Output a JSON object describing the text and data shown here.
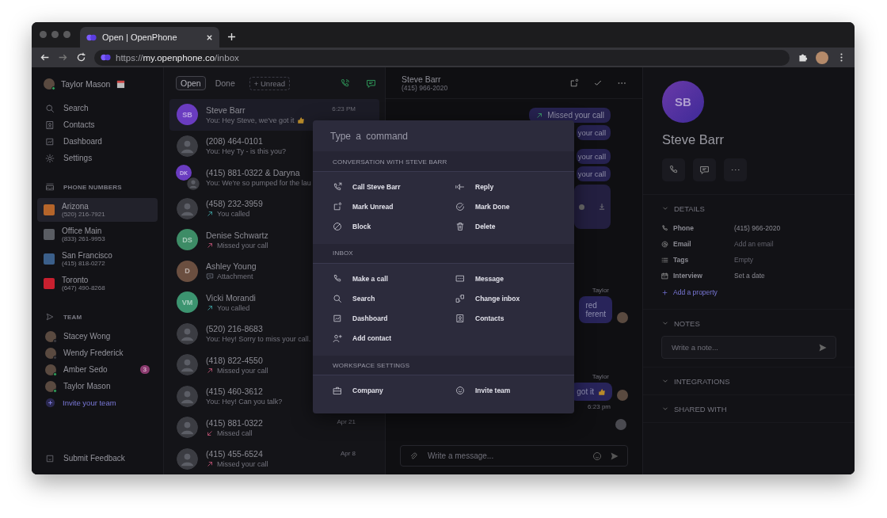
{
  "browser": {
    "tab_title": "Open | OpenPhone",
    "url_scheme": "https://",
    "url_host": "my.openphone.co",
    "url_path": "/inbox"
  },
  "sidebar": {
    "user": {
      "name": "Taylor Mason"
    },
    "nav": [
      {
        "label": "Search"
      },
      {
        "label": "Contacts"
      },
      {
        "label": "Dashboard"
      },
      {
        "label": "Settings"
      }
    ],
    "phone_numbers_heading": "PHONE NUMBERS",
    "phone_numbers": [
      {
        "name": "Arizona",
        "number": "(520) 216-7921",
        "selected": true,
        "color": "#b5652a"
      },
      {
        "name": "Office Main",
        "number": "(833) 261-9953",
        "selected": false,
        "color": "#5a5d63"
      },
      {
        "name": "San Francisco",
        "number": "(415) 818-0272",
        "selected": false,
        "color": "#3b5f8a"
      },
      {
        "name": "Toronto",
        "number": "(647) 490-8268",
        "selected": false,
        "color": "#c8202f"
      }
    ],
    "team_heading": "TEAM",
    "team": [
      {
        "name": "Stacey Wong",
        "online": false
      },
      {
        "name": "Wendy Frederick",
        "online": false
      },
      {
        "name": "Amber Sedo",
        "online": true,
        "badge": "3"
      },
      {
        "name": "Taylor Mason",
        "online": true
      }
    ],
    "invite": "Invite your team",
    "feedback": "Submit Feedback"
  },
  "inbox": {
    "filters": [
      {
        "label": "Open",
        "selected": true
      },
      {
        "label": "Done",
        "selected": false
      },
      {
        "label": "+ Unread",
        "selected": false
      }
    ],
    "conversations": [
      {
        "name": "Steve Barr",
        "preview": "You: Hey Steve, we've got it",
        "kind": "text",
        "thumbs": true,
        "avatar": {
          "kind": "initials",
          "initials": "SB",
          "color": "#6a3cc0"
        },
        "time": "6:23 PM",
        "selected": true
      },
      {
        "name": "(208) 464-0101",
        "preview": "You: Hey Ty - is this you?",
        "kind": "text",
        "avatar": {
          "kind": "contact"
        },
        "selected": false
      },
      {
        "name": "(415) 881-0322 & Daryna",
        "preview": "You: We're so pumped for the lau",
        "kind": "text",
        "avatar": {
          "kind": "group",
          "initials": "DK",
          "color": "#6a3cc0"
        },
        "selected": false
      },
      {
        "name": "(458) 232-3959",
        "preview": "You called",
        "kind": "outgoing_call",
        "avatar": {
          "kind": "contact"
        },
        "selected": false
      },
      {
        "name": "Denise Schwartz",
        "preview": "Missed your call",
        "kind": "missed_call",
        "avatar": {
          "kind": "initials",
          "initials": "DS",
          "color": "#3d8c66"
        },
        "selected": false
      },
      {
        "name": "Ashley Young",
        "preview": "Attachment",
        "kind": "attachment",
        "avatar": {
          "kind": "initials",
          "initials": "D",
          "color": "#6b4f40"
        },
        "selected": false
      },
      {
        "name": "Vicki Morandi",
        "preview": "You called",
        "kind": "outgoing_call",
        "avatar": {
          "kind": "initials",
          "initials": "VM",
          "color": "#3c9470"
        },
        "selected": false
      },
      {
        "name": "(520) 216-8683",
        "preview": "You: Hey! Sorry to miss your call.",
        "kind": "text",
        "avatar": {
          "kind": "contact"
        },
        "selected": false
      },
      {
        "name": "(418) 822-4550",
        "preview": "Missed your call",
        "kind": "missed_call",
        "avatar": {
          "kind": "contact"
        },
        "selected": false
      },
      {
        "name": "(415) 460-3612",
        "preview": "You: Hey! Can you talk?",
        "kind": "text",
        "avatar": {
          "kind": "contact"
        },
        "selected": false
      },
      {
        "name": "(415) 881-0322",
        "preview": "Missed call",
        "kind": "missed_incoming",
        "avatar": {
          "kind": "contact"
        },
        "time": "Apr 21",
        "selected": false
      },
      {
        "name": "(415) 455-6524",
        "preview": "Missed your call",
        "kind": "missed_call",
        "avatar": {
          "kind": "contact"
        },
        "time": "Apr 8",
        "selected": false
      }
    ]
  },
  "chat": {
    "name": "Steve Barr",
    "number": "(415) 966-2020",
    "messages": [
      {
        "kind": "call",
        "text": "Missed your call"
      },
      {
        "kind": "call",
        "text": "your call"
      },
      {
        "kind": "call",
        "text": "your call"
      },
      {
        "kind": "call",
        "text": "your call"
      },
      {
        "kind": "voicemail"
      },
      {
        "kind": "author",
        "text": "Taylor"
      },
      {
        "kind": "text",
        "text": "red\nferent"
      },
      {
        "kind": "author",
        "text": "Taylor"
      },
      {
        "kind": "text",
        "text": "got it",
        "thumbs": true
      },
      {
        "kind": "time",
        "text": "6:23 pm"
      },
      {
        "kind": "seen"
      }
    ],
    "composer_placeholder": "Write a message..."
  },
  "contact": {
    "initials": "SB",
    "name": "Steve Barr",
    "details_heading": "DETAILS",
    "properties": [
      {
        "label": "Phone",
        "value": "(415) 966-2020",
        "empty": false
      },
      {
        "label": "Email",
        "value": "Add an email",
        "empty": true
      },
      {
        "label": "Tags",
        "value": "Empty",
        "empty": true
      },
      {
        "label": "Interview",
        "value": "Set a date",
        "empty": false
      }
    ],
    "add_property": "Add a property",
    "notes_heading": "NOTES",
    "note_placeholder": "Write a note...",
    "integrations_heading": "INTEGRATIONS",
    "shared_heading": "SHARED WITH"
  },
  "palette": {
    "placeholder": "Type a command",
    "groups": [
      {
        "heading": "CONVERSATION WITH STEVE BARR",
        "items": [
          {
            "label": "Call Steve Barr"
          },
          {
            "label": "Reply"
          },
          {
            "label": "Mark Unread"
          },
          {
            "label": "Mark Done"
          },
          {
            "label": "Block"
          },
          {
            "label": "Delete"
          }
        ]
      },
      {
        "heading": "INBOX",
        "items": [
          {
            "label": "Make a call"
          },
          {
            "label": "Message"
          },
          {
            "label": "Search"
          },
          {
            "label": "Change inbox"
          },
          {
            "label": "Dashboard"
          },
          {
            "label": "Contacts"
          },
          {
            "label": "Add contact"
          }
        ]
      },
      {
        "heading": "WORKSPACE SETTINGS",
        "items": [
          {
            "label": "Company"
          },
          {
            "label": "Invite team"
          }
        ]
      }
    ]
  }
}
